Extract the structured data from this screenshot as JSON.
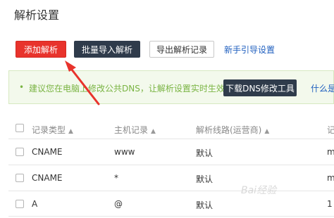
{
  "page": {
    "title": "解析设置"
  },
  "toolbar": {
    "add_label": "添加解析",
    "import_label": "批量导入解析",
    "export_label": "导出解析记录",
    "guide_label": "新手引导设置"
  },
  "notice": {
    "bullet": "•",
    "text": "建议您在电脑上修改公共DNS，让解析设置实时生效。",
    "download_label": "下载DNS修改工具",
    "more_label": "什么是"
  },
  "table": {
    "headers": [
      "记录类型",
      "主机记录",
      "解析线路(运营商)",
      "记"
    ],
    "sort_icon": "▲",
    "rows": [
      {
        "type": "CNAME",
        "host": "www",
        "line": "默认",
        "extra": "m"
      },
      {
        "type": "CNAME",
        "host": "*",
        "line": "默认",
        "extra": "m"
      },
      {
        "type": "A",
        "host": "@",
        "line": "默认",
        "extra": "1"
      }
    ]
  },
  "annotation": {
    "arrow_color": "#e8332c"
  },
  "watermark": {
    "text": "Bai经验"
  }
}
